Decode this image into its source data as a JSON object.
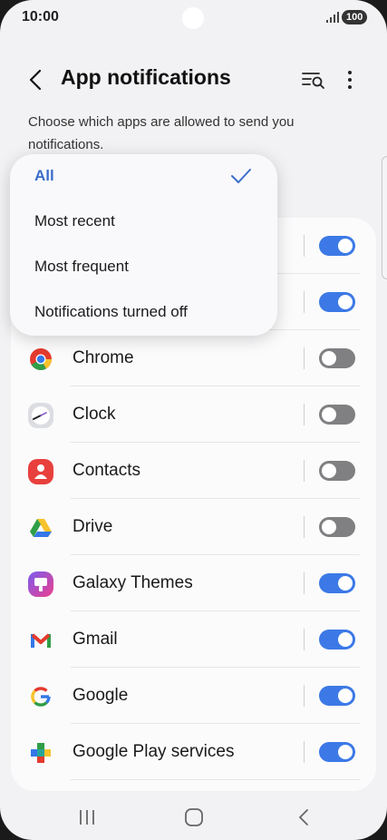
{
  "status_bar": {
    "time": "10:00",
    "battery": "100"
  },
  "header": {
    "title": "App notifications"
  },
  "description": "Choose which apps are allowed to send you notifications.",
  "dropdown": {
    "options": [
      {
        "label": "All",
        "selected": true
      },
      {
        "label": "Most recent",
        "selected": false
      },
      {
        "label": "Most frequent",
        "selected": false
      },
      {
        "label": "Notifications turned off",
        "selected": false
      }
    ]
  },
  "apps": [
    {
      "name": "",
      "enabled": true
    },
    {
      "name": "",
      "enabled": true
    },
    {
      "name": "Chrome",
      "icon": "chrome-icon",
      "enabled": false
    },
    {
      "name": "Clock",
      "icon": "clock-icon",
      "enabled": false
    },
    {
      "name": "Contacts",
      "icon": "contacts-icon",
      "enabled": false
    },
    {
      "name": "Drive",
      "icon": "drive-icon",
      "enabled": false
    },
    {
      "name": "Galaxy Themes",
      "icon": "galaxy-themes-icon",
      "enabled": true
    },
    {
      "name": "Gmail",
      "icon": "gmail-icon",
      "enabled": true
    },
    {
      "name": "Google",
      "icon": "google-icon",
      "enabled": true
    },
    {
      "name": "Google Play services",
      "icon": "google-play-services-icon",
      "enabled": true
    }
  ],
  "colors": {
    "accent": "#3c79e6",
    "toggle_off": "#808083",
    "selected_option": "#3a6ec9"
  }
}
